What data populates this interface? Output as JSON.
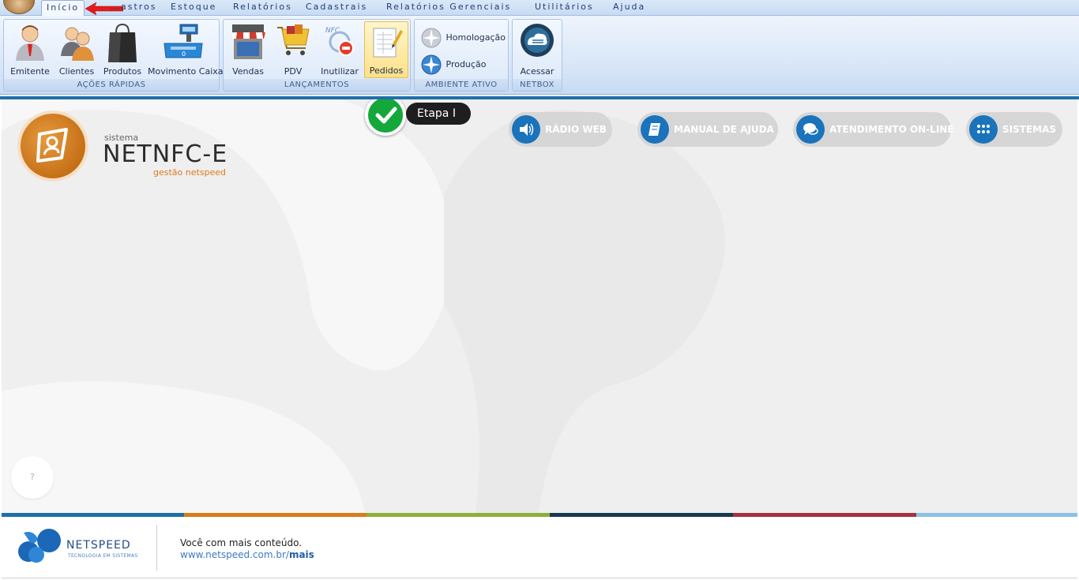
{
  "menu": {
    "items": [
      "Início",
      "…astros",
      "Estoque",
      "Relatórios",
      "Cadastrais",
      "Relatórios Gerenciais",
      "Utilitários",
      "Ajuda"
    ]
  },
  "ribbon": {
    "acoes_rapidas": {
      "caption": "AÇÕES RÁPIDAS",
      "buttons": [
        "Emitente",
        "Clientes",
        "Produtos",
        "Movimento Caixa"
      ]
    },
    "lancamentos": {
      "caption": "LANÇAMENTOS",
      "buttons": [
        "Vendas",
        "PDV",
        "Inutilizar",
        "Pedidos"
      ]
    },
    "ambiente": {
      "caption": "AMBIENTE ATIVO",
      "buttons": [
        "Homologação",
        "Produção"
      ]
    },
    "netbox": {
      "caption": "NETBOX",
      "buttons": [
        "Acessar"
      ]
    }
  },
  "callout": {
    "label": "Etapa I"
  },
  "brand": {
    "small": "sistema",
    "name": "NETNFC-E",
    "sub": "gestão netspeed"
  },
  "pills": [
    "RÁDIO WEB",
    "MANUAL DE AJUDA",
    "ATENDIMENTO ON-LINE",
    "SISTEMAS"
  ],
  "help": {
    "label": "?"
  },
  "footer": {
    "company": "NETSPEED",
    "tagline": "TECNOLOGIA EM SISTEMAS",
    "text": "Você com mais conteúdo.",
    "link_prefix": "www.netspeed.com.br/",
    "link_suffix": "mais"
  },
  "colors": {
    "accent_blue": "#1f6fa9",
    "orange": "#d97c1c",
    "color_bar": [
      "#1f6fa9",
      "#d97c1c",
      "#8fae3c",
      "#173a4f",
      "#a33342",
      "#8cc0e8"
    ]
  }
}
